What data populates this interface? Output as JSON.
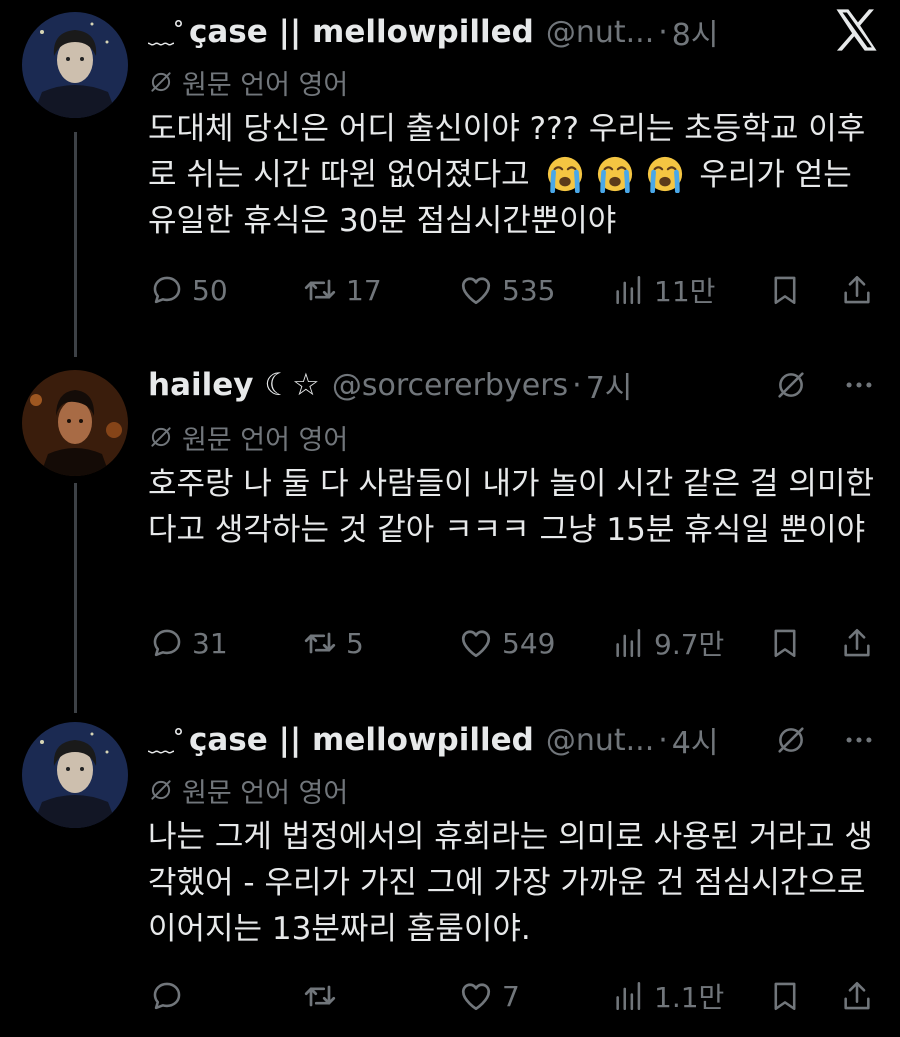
{
  "translate_label": "원문 언어 영어",
  "tweets": [
    {
      "deco": "﹏˚",
      "name": "ҫase || mellowpilled",
      "handle": "@nut...",
      "dot": "·",
      "time": "8시",
      "text_before": "도대체 당신은 어디 출신이야 ??? 우리는 초등학교 이후로 쉬는 시간 따윈 없어졌다고",
      "emoji_name": "loudly-crying-face",
      "text_after": "우리가 얻는 유일한 휴식은 30분 점심시간뿐이야",
      "replies": "50",
      "reposts": "17",
      "likes": "535",
      "views": "11만"
    },
    {
      "name": "hailey ☾☆",
      "handle": "@sorcererbyers",
      "dot": "·",
      "time": "7시",
      "text": "호주랑 나 둘 다 사람들이 내가 놀이 시간 같은 걸 의미한다고 생각하는 것 같아 ㅋㅋㅋ 그냥 15분 휴식일 뿐이야",
      "replies": "31",
      "reposts": "5",
      "likes": "549",
      "views": "9.7만"
    },
    {
      "deco": "﹏˚",
      "name": "ҫase || mellowpilled",
      "handle": "@nut...",
      "dot": "·",
      "time": "4시",
      "text": "나는 그게 법정에서의 휴회라는 의미로 사용된 거라고 생각했어 - 우리가 가진 그에 가장 가까운 건 점심시간으로 이어지는 13분짜리 홈룸이야.",
      "replies": "",
      "reposts": "",
      "likes": "7",
      "views": "1.1만"
    }
  ],
  "colors": {
    "background": "#000000",
    "text": "#e7e9ea",
    "muted": "#71767b",
    "thread_line": "#3d4146"
  }
}
